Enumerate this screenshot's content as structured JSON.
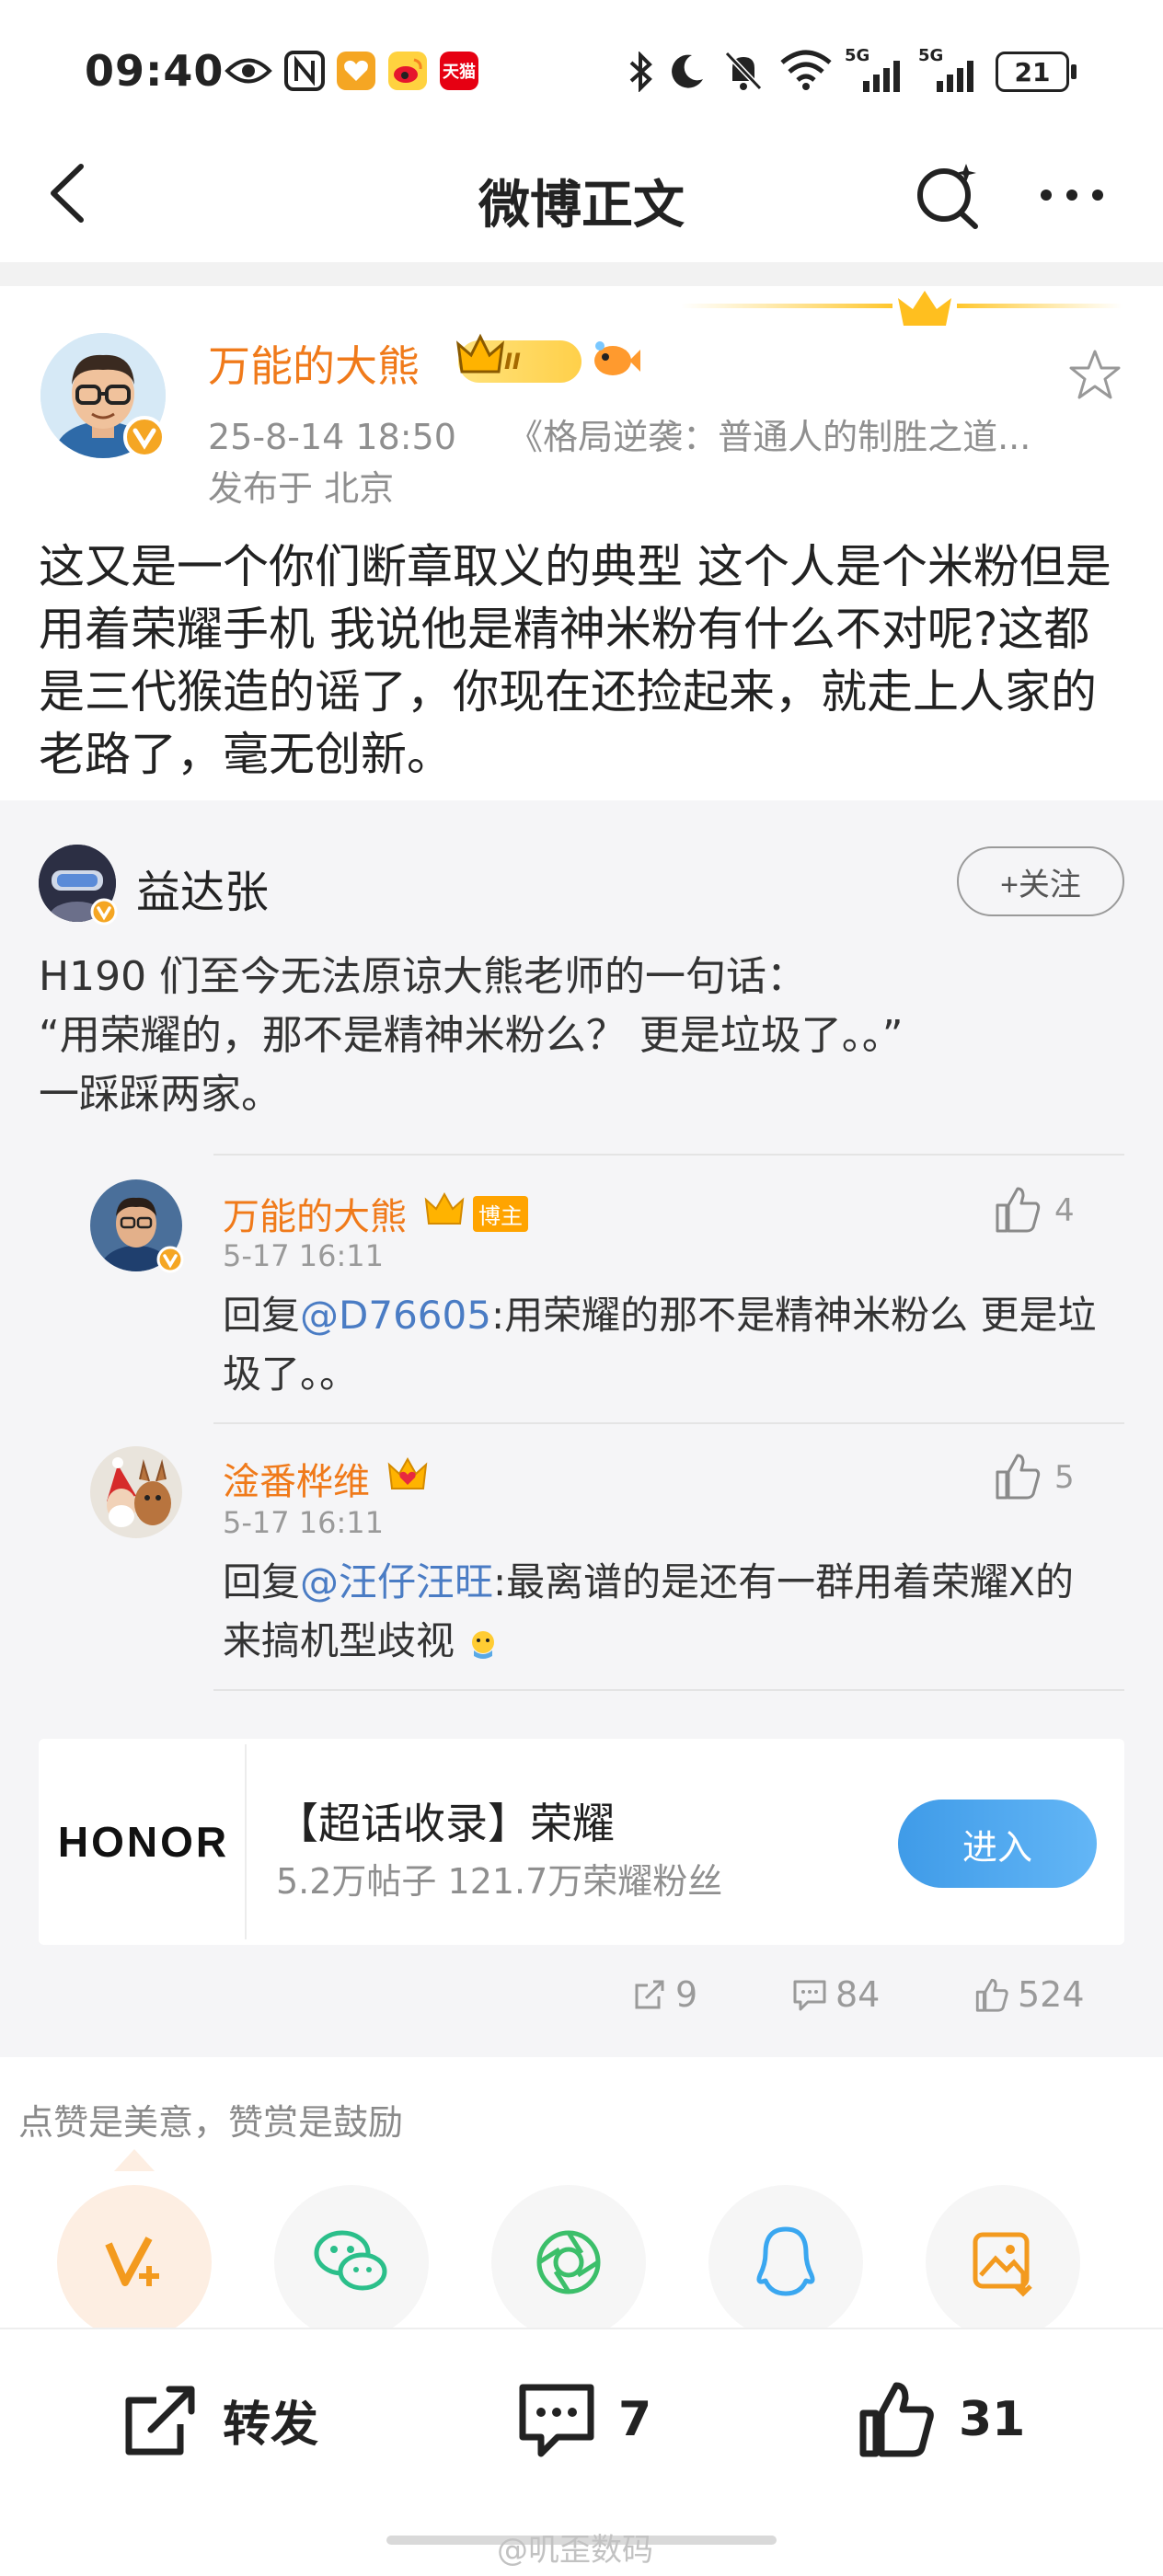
{
  "status_bar": {
    "time": "09:40",
    "battery": "21",
    "network_1": "5G",
    "network_2": "5G",
    "app_badge_tmall": "天猫",
    "icons": [
      "eye-icon",
      "nfc-icon",
      "heart-badge-icon",
      "weibo-icon",
      "tmall-icon",
      "bluetooth-icon",
      "moon-icon",
      "bell-off-icon",
      "wifi-icon",
      "signal-icon",
      "battery-icon"
    ]
  },
  "nav": {
    "title": "微博正文"
  },
  "post": {
    "author_name": "万能的大熊",
    "level_badge": "II",
    "timestamp": "25-8-14 18:50",
    "source": "《格局逆袭：普通人的制胜之道...",
    "location": "发布于 北京",
    "text": "这又是一个你们断章取义的典型 这个人是个米粉但是用着荣耀手机 我说他是精神米粉有什么不对呢?这都是三代猴造的谣了，你现在还捡起来，就走上人家的老路了，毫无创新。"
  },
  "repost": {
    "author_name": "益达张",
    "follow_label": "+关注",
    "text": "H190 们至今无法原谅大熊老师的一句话：\n“用荣耀的，那不是精神米粉么？ 更是垃圾了。。”\n一踩踩两家。",
    "replies": [
      {
        "name": "万能的大熊",
        "badge": "博主",
        "time": "5-17 16:11",
        "reply_prefix": "回复",
        "mention": "@D76605",
        "text": ":用荣耀的那不是精神米粉么 更是垃圾了。。",
        "likes": "4"
      },
      {
        "name": "淦番桦维",
        "time": "5-17 16:11",
        "reply_prefix": "回复",
        "mention": "@汪仔汪旺",
        "text": ":最离谱的是还有一群用着荣耀X的来搞机型歧视",
        "likes": "5"
      }
    ],
    "supertopic": {
      "logo_text": "HONOR",
      "title": "【超话收录】荣耀",
      "stats": "5.2万帖子 121.7万荣耀粉丝",
      "enter_label": "进入"
    },
    "actions": {
      "reposts": "9",
      "comments": "84",
      "likes": "524"
    }
  },
  "reward": {
    "caption": "点赞是美意，赞赏是鼓励",
    "share_targets": [
      "vplus-icon",
      "wechat-icon",
      "moments-icon",
      "qq-icon",
      "save-image-icon"
    ]
  },
  "bottom_bar": {
    "repost_label": "转发",
    "comment_count": "7",
    "like_count": "31"
  },
  "watermark": "@叽歪数码",
  "colors": {
    "accent_orange": "#f07a1a",
    "link_blue": "#4a7cc4",
    "enter_button": "#4aa6ee"
  }
}
